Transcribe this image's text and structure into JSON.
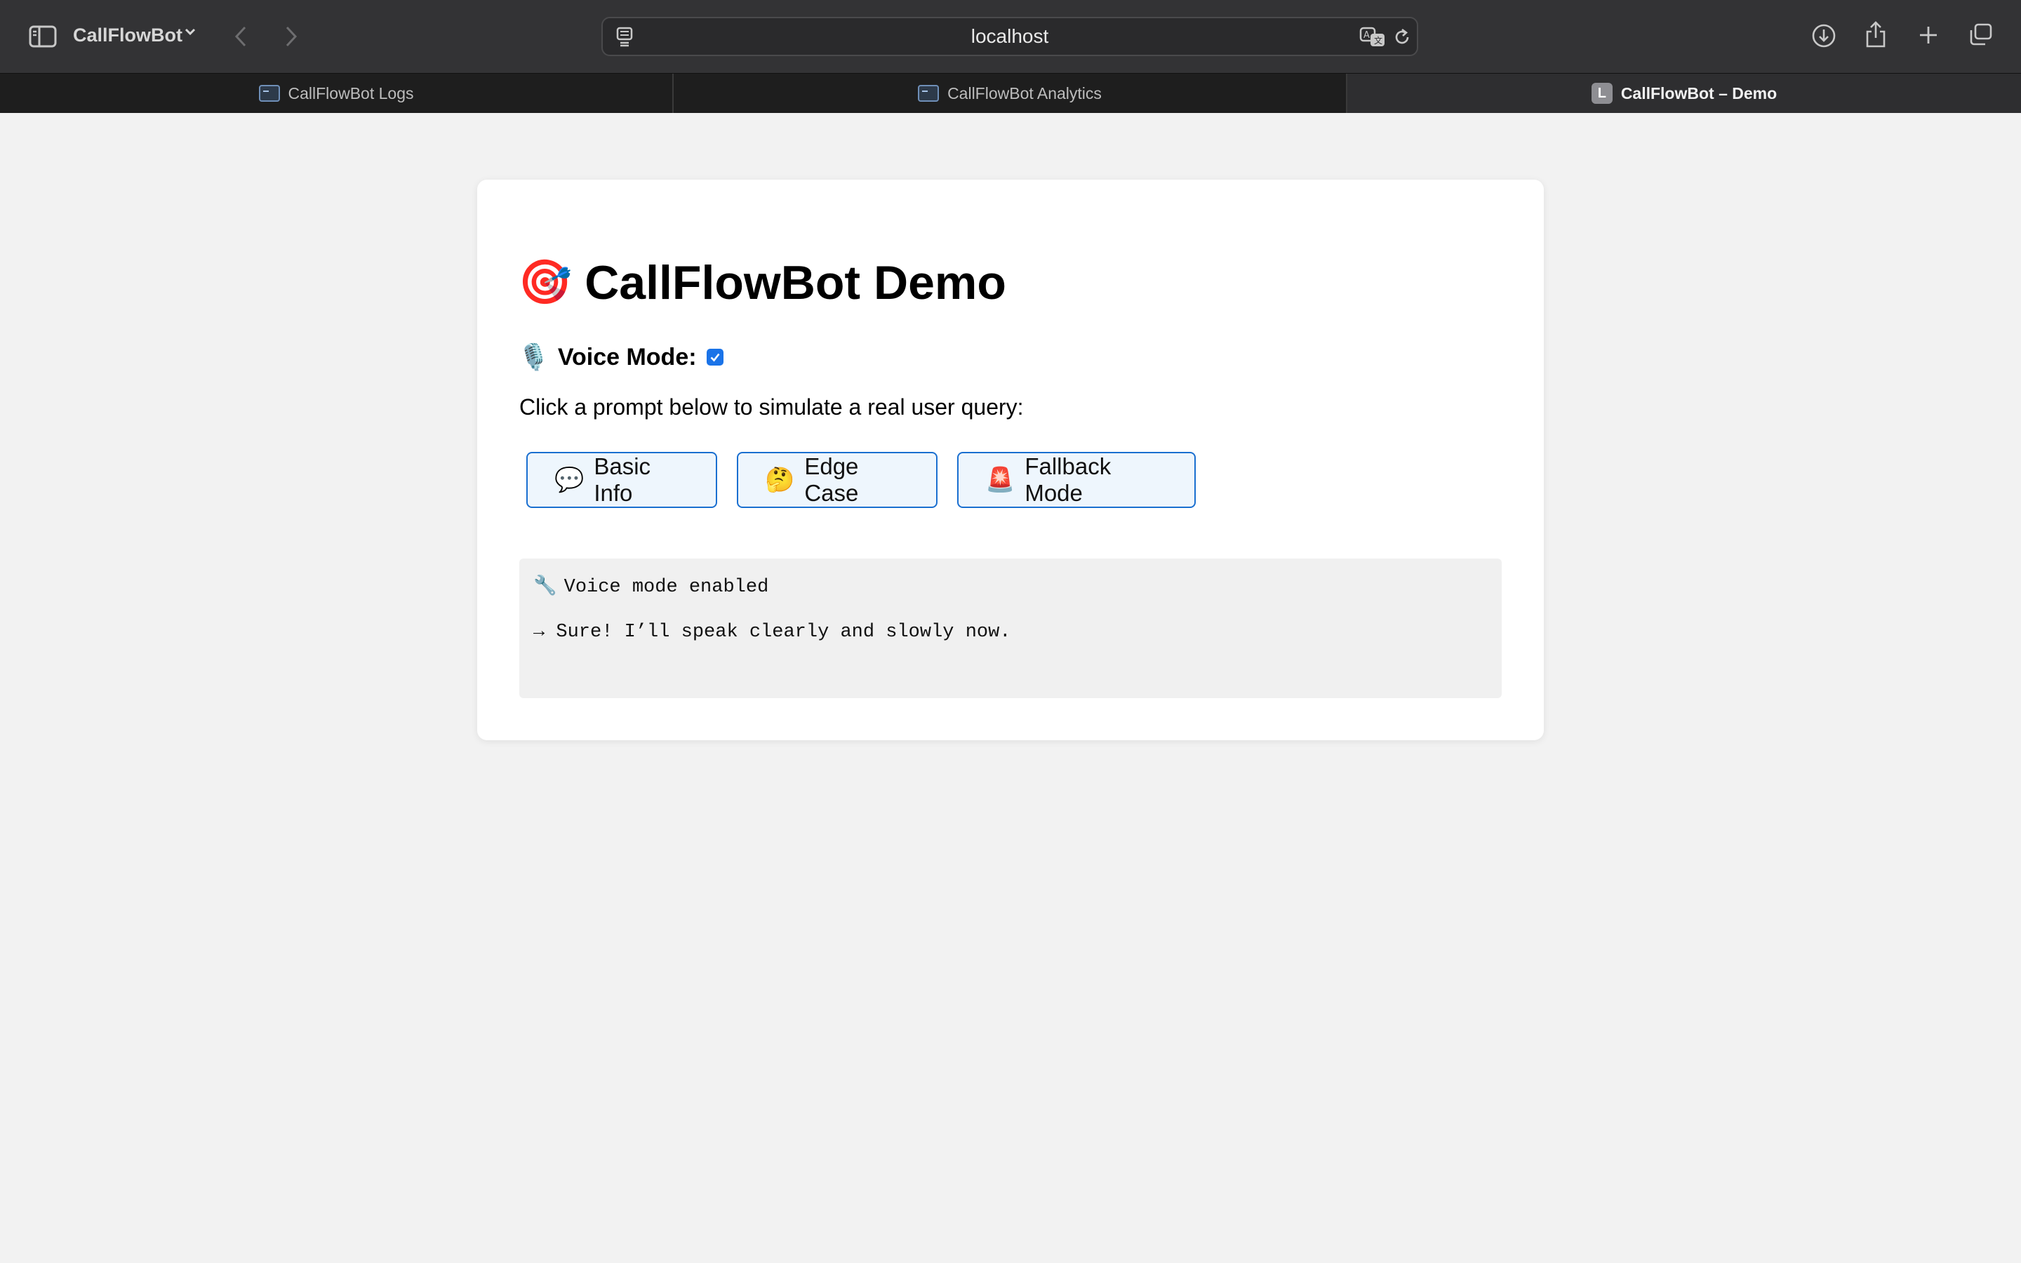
{
  "browser": {
    "profile_name": "CallFlowBot",
    "address": "localhost",
    "tabs": [
      {
        "title": "CallFlowBot Logs",
        "active": false
      },
      {
        "title": "CallFlowBot Analytics",
        "active": false
      },
      {
        "title": "CallFlowBot – Demo",
        "active": true,
        "favicon_letter": "L"
      }
    ],
    "icons": {
      "sidebar": "sidebar-icon",
      "back": "back-icon",
      "forward": "forward-icon",
      "page_settings": "page-settings-icon",
      "translate": "translate-icon",
      "reload": "reload-icon",
      "downloads": "download-icon",
      "share": "share-icon",
      "new_tab": "plus-icon",
      "tab_overview": "tab-overview-icon"
    }
  },
  "page": {
    "title_emoji": "🎯",
    "title": "CallFlowBot Demo",
    "voice_mode": {
      "emoji": "🎙️",
      "label": "Voice Mode:",
      "checked": true
    },
    "instructions": "Click a prompt below to simulate a real user query:",
    "prompts": [
      {
        "emoji": "💬",
        "label": "Basic Info"
      },
      {
        "emoji": "🤔",
        "label": "Edge Case"
      },
      {
        "emoji": "🚨",
        "label": "Fallback Mode"
      }
    ],
    "output": {
      "line1_emoji": "🔧",
      "line1": "Voice mode enabled",
      "line2": "→ Sure! I’ll speak clearly and slowly now."
    }
  },
  "colors": {
    "accent": "#1a73e8",
    "button_border": "#1a6fd0",
    "button_bg": "#eef6fd",
    "page_bg": "#f2f2f2",
    "output_bg": "#f0f0f0"
  }
}
